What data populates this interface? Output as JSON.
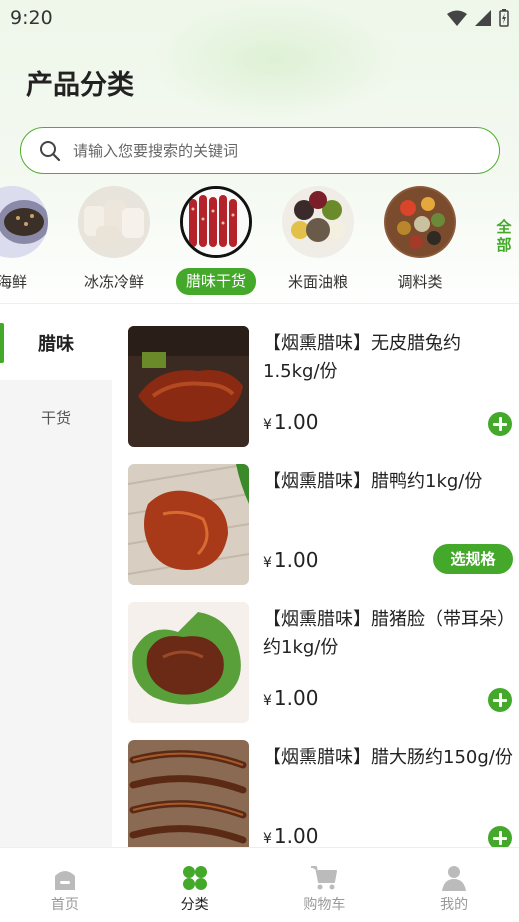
{
  "status": {
    "time": "9:20"
  },
  "page": {
    "title": "产品分类"
  },
  "search": {
    "placeholder": "请输入您要搜索的关键词"
  },
  "categories": [
    {
      "label": "海鲜",
      "icon": "seafood-thumb"
    },
    {
      "label": "冰冻冷鲜",
      "icon": "frozen-thumb"
    },
    {
      "label": "腊味干货",
      "icon": "cured-meat-thumb",
      "active": true
    },
    {
      "label": "米面油粮",
      "icon": "grain-thumb"
    },
    {
      "label": "调料类",
      "icon": "spice-thumb"
    }
  ],
  "all_categories": {
    "label": "全部"
  },
  "sidebar": {
    "items": [
      {
        "label": "腊味",
        "active": true
      },
      {
        "label": "干货"
      }
    ]
  },
  "products": [
    {
      "name": "【烟熏腊味】无皮腊兔约1.5kg/份",
      "currency": "¥",
      "price": "1.00",
      "action": "add"
    },
    {
      "name": "【烟熏腊味】腊鸭约1kg/份",
      "currency": "¥",
      "price": "1.00",
      "action": "spec",
      "action_label": "选规格"
    },
    {
      "name": "【烟熏腊味】腊猪脸（带耳朵）约1kg/份",
      "currency": "¥",
      "price": "1.00",
      "action": "add"
    },
    {
      "name": "【烟熏腊味】腊大肠约150g/份",
      "currency": "¥",
      "price": "1.00",
      "action": "add"
    }
  ],
  "tabbar": {
    "items": [
      {
        "label": "首页",
        "icon": "home-icon"
      },
      {
        "label": "分类",
        "icon": "category-icon",
        "active": true
      },
      {
        "label": "购物车",
        "icon": "cart-icon"
      },
      {
        "label": "我的",
        "icon": "profile-icon"
      }
    ]
  },
  "colors": {
    "accent": "#44a92a",
    "text": "#222222",
    "muted": "#999999"
  }
}
